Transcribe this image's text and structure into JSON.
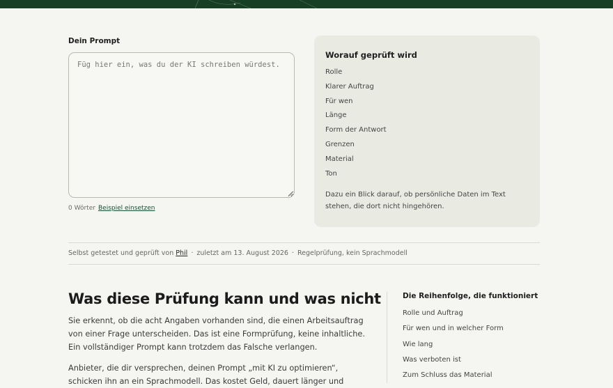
{
  "prompt": {
    "label": "Dein Prompt",
    "placeholder": "Füg hier ein, was du der KI schreiben würdest.",
    "value": "",
    "word_count": "0 Wörter",
    "example_link": "Beispiel einsetzen"
  },
  "checks": {
    "title": "Worauf geprüft wird",
    "items": [
      "Rolle",
      "Klarer Auftrag",
      "Für wen",
      "Länge",
      "Form der Antwort",
      "Grenzen",
      "Material",
      "Ton"
    ],
    "note": "Dazu ein Blick darauf, ob persönliche Daten im Text stehen, die dort nicht hingehören."
  },
  "meta": {
    "prefix": "Selbst getestet und geprüft von",
    "author": "Phil",
    "separator": "·",
    "updated": "zuletzt am 13. August 2026",
    "method": "Regelprüfung, kein Sprachmodell"
  },
  "article": {
    "title": "Was diese Prüfung kann und was nicht",
    "p1": "Sie erkennt, ob die acht Angaben vorhanden sind, die einen Arbeitsauftrag von einer Frage unterscheiden. Das ist eine Formprüfung, keine inhaltliche. Ein vollständiger Prompt kann trotzdem das Falsche verlangen.",
    "p2": "Anbieter, die dir versprechen, deinen Prompt „mit KI zu optimieren“, schicken ihn an ein Sprachmodell. Das kostet Geld, dauert länger und"
  },
  "sidebar": {
    "title": "Die Reihenfolge, die funktioniert",
    "items": [
      "Rolle und Auftrag",
      "Für wen und in welcher Form",
      "Wie lang",
      "Was verboten ist",
      "Zum Schluss das Material"
    ]
  },
  "colors": {
    "header_green": "#173f26",
    "link_green": "#1e4a2e",
    "panel_bg": "#e9ebe3",
    "page_bg": "#f5f5f2"
  }
}
